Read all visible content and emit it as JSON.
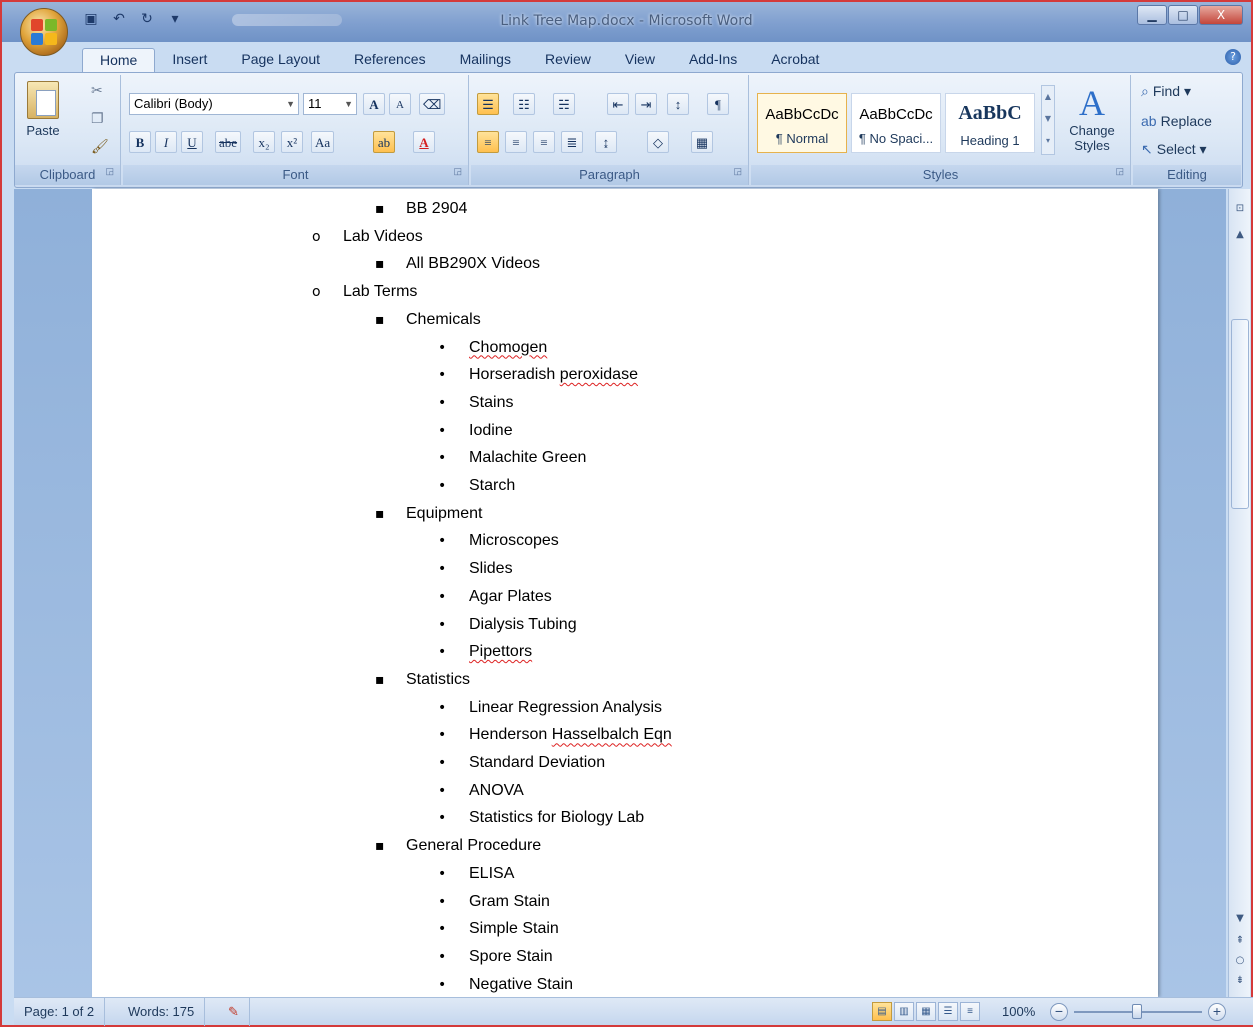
{
  "window": {
    "title": "Link Tree Map.docx - Microsoft Word",
    "minimize": "▁",
    "maximize": "□",
    "close": "X"
  },
  "tabs": [
    {
      "label": "Home",
      "active": true
    },
    {
      "label": "Insert"
    },
    {
      "label": "Page Layout"
    },
    {
      "label": "References"
    },
    {
      "label": "Mailings"
    },
    {
      "label": "Review"
    },
    {
      "label": "View"
    },
    {
      "label": "Add-Ins"
    },
    {
      "label": "Acrobat"
    }
  ],
  "ribbon": {
    "clipboard": {
      "label": "Clipboard",
      "paste": "Paste"
    },
    "font": {
      "label": "Font",
      "family": "Calibri (Body)",
      "size": "11",
      "grow": "A",
      "shrink": "A",
      "bold": "B",
      "italic": "I",
      "underline": "U",
      "strike": "abe",
      "subscript": "x₂",
      "superscript": "x²",
      "case": "Aa",
      "highlight": "ab",
      "color": "A"
    },
    "paragraph": {
      "label": "Paragraph",
      "show_marks": "¶"
    },
    "styles": {
      "label": "Styles",
      "items": [
        {
          "sample": "AaBbCcDc",
          "name": "¶ Normal"
        },
        {
          "sample": "AaBbCcDc",
          "name": "¶ No Spaci..."
        },
        {
          "sample": "AaBbC",
          "name": "Heading 1"
        }
      ],
      "change_styles": "Change Styles",
      "change_styles_glyph": "A"
    },
    "editing": {
      "label": "Editing",
      "find": "Find",
      "replace": "Replace",
      "select": "Select"
    }
  },
  "document": {
    "items": [
      {
        "level": 3,
        "text": "BB 2904"
      },
      {
        "level": 2,
        "text": "Lab Videos"
      },
      {
        "level": 3,
        "text": "All BB290X Videos"
      },
      {
        "level": 2,
        "text": "Lab Terms"
      },
      {
        "level": 3,
        "text": "Chemicals"
      },
      {
        "level": 4,
        "text": "Chomogen",
        "squiggle": true
      },
      {
        "level": 4,
        "text_plain": "Horseradish ",
        "text_squiggle": "peroxidase"
      },
      {
        "level": 4,
        "text": "Stains"
      },
      {
        "level": 4,
        "text": "Iodine"
      },
      {
        "level": 4,
        "text": "Malachite Green"
      },
      {
        "level": 4,
        "text": "Starch"
      },
      {
        "level": 3,
        "text": "Equipment"
      },
      {
        "level": 4,
        "text": "Microscopes"
      },
      {
        "level": 4,
        "text": "Slides"
      },
      {
        "level": 4,
        "text": "Agar Plates"
      },
      {
        "level": 4,
        "text": "Dialysis Tubing"
      },
      {
        "level": 4,
        "text": "Pipettors",
        "squiggle": true
      },
      {
        "level": 3,
        "text": "Statistics"
      },
      {
        "level": 4,
        "text": "Linear Regression Analysis"
      },
      {
        "level": 4,
        "text_plain": "Henderson ",
        "text_squiggle": "Hasselbalch Eqn"
      },
      {
        "level": 4,
        "text": "Standard Deviation"
      },
      {
        "level": 4,
        "text": "ANOVA"
      },
      {
        "level": 4,
        "text": "Statistics for Biology Lab"
      },
      {
        "level": 3,
        "text": "General Procedure"
      },
      {
        "level": 4,
        "text": "ELISA"
      },
      {
        "level": 4,
        "text": "Gram Stain"
      },
      {
        "level": 4,
        "text": "Simple Stain"
      },
      {
        "level": 4,
        "text": "Spore Stain"
      },
      {
        "level": 4,
        "text": "Negative Stain"
      }
    ]
  },
  "statusbar": {
    "page": "Page: 1 of 2",
    "words": "Words: 175",
    "zoom": "100%"
  },
  "colors": {
    "accent": "#2b579a",
    "frame_border": "#d43a3a",
    "squiggle": "#dd2222"
  }
}
